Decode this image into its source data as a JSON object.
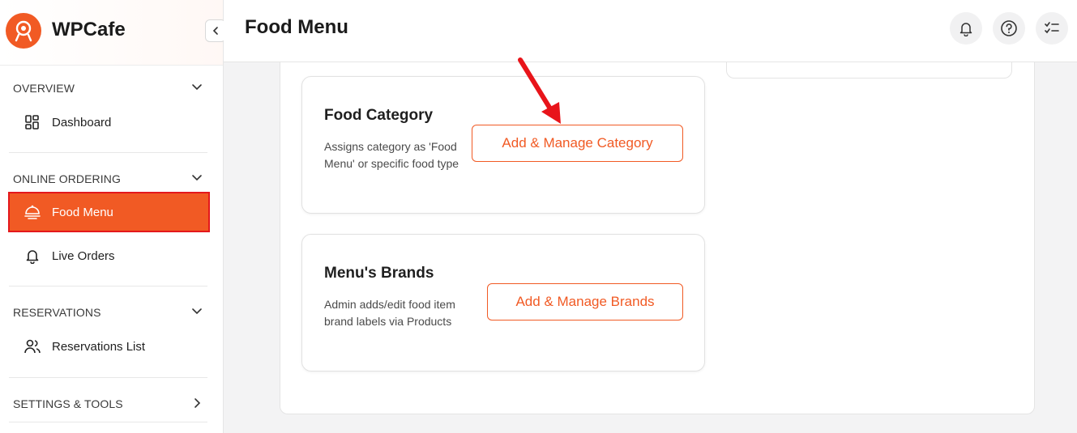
{
  "brand": {
    "name": "WPCafe"
  },
  "sidebar": {
    "sections": [
      {
        "title": "OVERVIEW",
        "items": [
          {
            "label": "Dashboard",
            "icon": "dashboard-grid-icon"
          }
        ]
      },
      {
        "title": "ONLINE ORDERING",
        "items": [
          {
            "label": "Food Menu",
            "icon": "food-dish-icon",
            "active": true
          },
          {
            "label": "Live Orders",
            "icon": "bell-icon"
          }
        ]
      },
      {
        "title": "RESERVATIONS",
        "items": [
          {
            "label": "Reservations List",
            "icon": "users-icon"
          }
        ]
      },
      {
        "title": "SETTINGS & TOOLS",
        "items": []
      }
    ]
  },
  "header": {
    "title": "Food Menu"
  },
  "cards": [
    {
      "title": "Food Category",
      "description": "Assigns category as 'Food Menu' or specific food type",
      "button": "Add & Manage Category"
    },
    {
      "title": "Menu's Brands",
      "description": "Admin adds/edit food item brand labels via Products",
      "button": "Add & Manage Brands"
    }
  ],
  "colors": {
    "accent": "#f15a24",
    "highlight_border": "#e4181c",
    "arrow": "#e8141a"
  }
}
